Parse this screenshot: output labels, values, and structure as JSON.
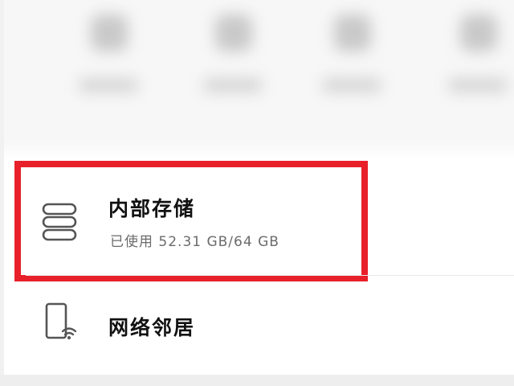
{
  "storage_item": {
    "title": "内部存储",
    "subtitle": "已使用 52.31 GB/64 GB",
    "icon": "storage-stack-icon",
    "highlight_color": "#e8202a"
  },
  "network_item": {
    "title": "网络邻居",
    "icon": "phone-wifi-icon"
  },
  "colors": {
    "title_text": "#111111",
    "subtitle_text": "#6b6b6b",
    "divider": "#e8e8e8"
  }
}
